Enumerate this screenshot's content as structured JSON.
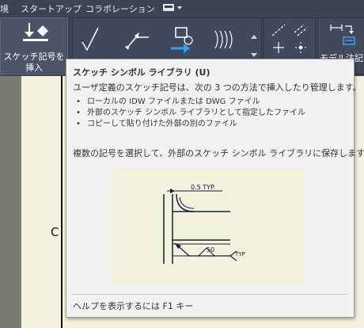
{
  "menu": {
    "item_env": "境",
    "item_startup": "スタートアップ",
    "item_collab": "コラボレーション"
  },
  "ribbon": {
    "insert_sketch_symbol_line1": "スケッチ記号を",
    "insert_sketch_symbol_line2": "挿入",
    "model_annotation": "モデル注記を"
  },
  "drawing": {
    "zone_letter": "C"
  },
  "tooltip": {
    "title": "スケッチ シンボル ライブラリ (U)",
    "description": "ユーザ定義のスケッチ記号は、次の 3 つの方法で挿入したり管理します。",
    "bullets": [
      "ローカルの IDW ファイルまたは DWG ファイル",
      "外部のスケッチ シンボル ライブラリとして指定したファイル",
      "コピーして貼り付けた外部の別のファイル"
    ],
    "note": "複数の記号を選択して、外部のスケッチ シンボル ライブラリに保存します。",
    "image": {
      "dim_label": "0.5 TYP",
      "weld_value": "50",
      "weld_note": "TYP"
    },
    "help": "ヘルプを表示するには F1 キー"
  },
  "colors": {
    "ribbon_bg": "#3b4453",
    "accent_blue": "#3aa0ff",
    "paper": "#f3f2de"
  }
}
